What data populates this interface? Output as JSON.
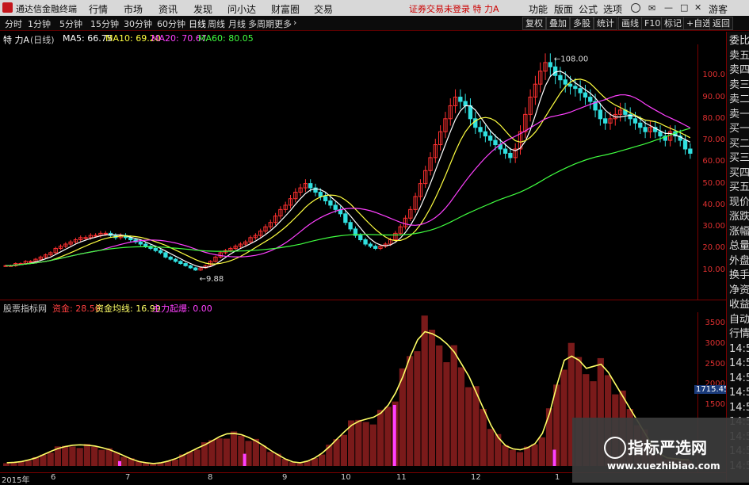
{
  "titlebar": {
    "app_title": "通达信金融终端",
    "menu": [
      "行情",
      "市场",
      "资讯",
      "发现",
      "问小达",
      "财富圈",
      "交易"
    ],
    "center_notice": "证券交易未登录 特 力A",
    "right": [
      "功能",
      "版面",
      "公式",
      "选项",
      "游客"
    ]
  },
  "toolbar": {
    "periods": [
      "分时",
      "1分钟",
      "5分钟",
      "15分钟",
      "30分钟",
      "60分钟",
      "日线",
      "周线",
      "月线",
      "多周期",
      "更多"
    ],
    "active_period": "日线",
    "tools": [
      "复权",
      "叠加",
      "多股",
      "统计",
      "画线",
      "F10",
      "标记",
      "+自选",
      "返回"
    ]
  },
  "infobar": {
    "stock": "特 力A",
    "cycle": "(日线)",
    "ma5": "MA5: 66.75",
    "ma10": "MA10: 69.20",
    "ma20": "MA20: 70.67",
    "ma60": "MA60: 80.05",
    "colors": {
      "ma5": "#ffffff",
      "ma10": "#ffff40",
      "ma20": "#ff40ff",
      "ma60": "#40ff40"
    }
  },
  "price_axis": [
    "100.0",
    "90.00",
    "80.00",
    "70.00",
    "60.00",
    "50.00",
    "40.00",
    "30.00",
    "20.00",
    "10.00"
  ],
  "annotations": {
    "high": "108.00",
    "low": "9.88"
  },
  "subinfo": {
    "name": "股票指标网",
    "v1": "资金: 28.50",
    "v2": "资金均线: 16.99",
    "v3": "主力起爆: 0.00"
  },
  "sub_axis": [
    "3500",
    "3000",
    "2500",
    "2000",
    "1500"
  ],
  "sub_tag": "1715.45",
  "date_axis": [
    "2015年",
    "6",
    "7",
    "8",
    "9",
    "10",
    "11",
    "12",
    "1"
  ],
  "right_panel": [
    "委比",
    "卖五",
    "卖四",
    "卖三",
    "卖二",
    "卖一",
    "买一",
    "买二",
    "买三",
    "买四",
    "买五",
    "现价",
    "涨跌",
    "涨幅",
    "总量",
    "外盘",
    "换手",
    "净资",
    "收益",
    "自动",
    "行情",
    "14:5",
    "14:5",
    "14:5",
    "14:5",
    "14:5",
    "14:5",
    "14:5",
    "14:5",
    "14:5"
  ],
  "watermark": {
    "line1": "指标严选网",
    "line2": "www.xuezhibiao.com"
  },
  "chart_data": {
    "type": "line",
    "price_range": [
      9.88,
      108.0
    ],
    "closes": [
      12,
      12,
      13,
      13,
      14,
      14,
      15,
      16,
      17,
      18,
      20,
      21,
      22,
      23,
      24,
      25,
      25,
      26,
      26,
      27,
      27,
      26,
      25,
      26,
      25,
      24,
      23,
      22,
      21,
      20,
      19,
      18,
      16,
      15,
      14,
      13,
      12,
      11,
      10,
      11,
      12,
      14,
      16,
      18,
      19,
      20,
      21,
      22,
      23,
      25,
      26,
      28,
      30,
      32,
      35,
      38,
      40,
      43,
      46,
      48,
      50,
      48,
      46,
      44,
      42,
      40,
      38,
      36,
      32,
      29,
      26,
      24,
      22,
      21,
      20,
      21,
      22,
      24,
      27,
      30,
      34,
      38,
      44,
      50,
      56,
      62,
      68,
      74,
      80,
      86,
      90,
      88,
      86,
      80,
      76,
      74,
      72,
      70,
      68,
      66,
      64,
      62,
      66,
      74,
      82,
      90,
      96,
      102,
      106,
      104,
      100,
      98,
      96,
      95,
      94,
      92,
      90,
      88,
      84,
      80,
      78,
      80,
      82,
      84,
      82,
      80,
      78,
      76,
      74,
      76,
      74,
      72,
      70,
      74,
      72,
      70,
      66,
      64
    ],
    "fund": [
      80,
      90,
      110,
      150,
      200,
      280,
      360,
      430,
      480,
      510,
      520,
      510,
      490,
      450,
      400,
      330,
      250,
      170,
      110,
      80,
      60,
      80,
      120,
      180,
      260,
      350,
      440,
      520,
      620,
      720,
      790,
      800,
      770,
      700,
      610,
      500,
      380,
      270,
      170,
      100,
      80,
      120,
      200,
      320,
      480,
      660,
      840,
      1000,
      1100,
      1150,
      1200,
      1300,
      1500,
      1800,
      2200,
      2700,
      3100,
      3300,
      3250,
      3150,
      3000,
      2800,
      2500,
      2200,
      1800,
      1400,
      1000,
      700,
      500,
      420,
      400,
      450,
      550,
      800,
      1300,
      2000,
      2600,
      2700,
      2600,
      2400,
      2450,
      2500,
      2300,
      2000,
      1700,
      1400,
      1100,
      800,
      500,
      300,
      200,
      180,
      160,
      150
    ],
    "fund_ma_color": "#ffff66",
    "spikes": [
      {
        "i": 23,
        "v": 120
      },
      {
        "i": 48,
        "v": 300
      },
      {
        "i": 78,
        "v": 1500
      },
      {
        "i": 110,
        "v": 400
      }
    ]
  }
}
